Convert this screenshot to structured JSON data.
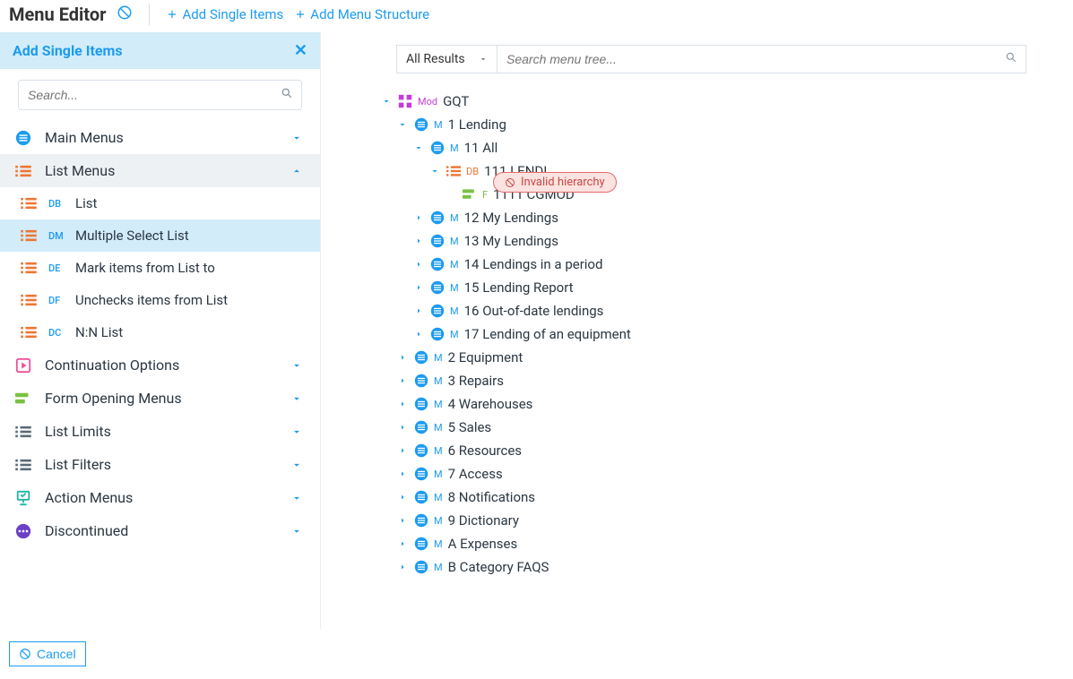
{
  "header": {
    "title": "Menu Editor",
    "add_single": "Add Single Items",
    "add_structure": "Add Menu Structure"
  },
  "sidebar": {
    "panel_title": "Add Single Items",
    "search_placeholder": "Search...",
    "categories": [
      {
        "id": "main-menus",
        "label": "Main Menus",
        "expanded": false,
        "type": "blue"
      },
      {
        "id": "list-menus",
        "label": "List Menus",
        "expanded": true,
        "type": "orange",
        "subs": [
          {
            "code": "DB",
            "label": "List",
            "selected": false
          },
          {
            "code": "DM",
            "label": "Multiple Select List",
            "selected": true
          },
          {
            "code": "DE",
            "label": "Mark items from List to",
            "selected": false
          },
          {
            "code": "DF",
            "label": "Unchecks items from List",
            "selected": false
          },
          {
            "code": "DC",
            "label": "N:N List",
            "selected": false
          }
        ]
      },
      {
        "id": "continuation",
        "label": "Continuation Options",
        "expanded": false,
        "type": "pink"
      },
      {
        "id": "form-opening",
        "label": "Form Opening Menus",
        "expanded": false,
        "type": "green"
      },
      {
        "id": "list-limits",
        "label": "List Limits",
        "expanded": false,
        "type": "grey"
      },
      {
        "id": "list-filters",
        "label": "List Filters",
        "expanded": false,
        "type": "grey"
      },
      {
        "id": "action-menus",
        "label": "Action Menus",
        "expanded": false,
        "type": "teal"
      },
      {
        "id": "discontinued",
        "label": "Discontinued",
        "expanded": false,
        "type": "purple"
      }
    ]
  },
  "main": {
    "filter_select": "All Results",
    "search_placeholder": "Search menu tree...",
    "invalid_badge": "Invalid hierarchy",
    "tree": {
      "type": "Mod",
      "code": "GQT",
      "expanded": true,
      "children": [
        {
          "type": "M",
          "code": "1",
          "label": "Lending",
          "expanded": true,
          "children": [
            {
              "type": "M",
              "code": "11",
              "label": "All",
              "expanded": true,
              "children": [
                {
                  "type": "DB",
                  "code": "111",
                  "label": "LENDI",
                  "expanded": true,
                  "db": true,
                  "children": [
                    {
                      "type": "F",
                      "code": "1111",
                      "label": "CGMOD",
                      "leaf": true,
                      "invalid": true
                    }
                  ]
                }
              ]
            },
            {
              "type": "M",
              "code": "12",
              "label": "My Lendings"
            },
            {
              "type": "M",
              "code": "13",
              "label": "My Lendings"
            },
            {
              "type": "M",
              "code": "14",
              "label": "Lendings in a period"
            },
            {
              "type": "M",
              "code": "15",
              "label": "Lending Report"
            },
            {
              "type": "M",
              "code": "16",
              "label": "Out-of-date lendings"
            },
            {
              "type": "M",
              "code": "17",
              "label": "Lending of an equipment"
            }
          ]
        },
        {
          "type": "M",
          "code": "2",
          "label": "Equipment"
        },
        {
          "type": "M",
          "code": "3",
          "label": "Repairs"
        },
        {
          "type": "M",
          "code": "4",
          "label": "Warehouses"
        },
        {
          "type": "M",
          "code": "5",
          "label": "Sales"
        },
        {
          "type": "M",
          "code": "6",
          "label": "Resources"
        },
        {
          "type": "M",
          "code": "7",
          "label": "Access"
        },
        {
          "type": "M",
          "code": "8",
          "label": "Notifications"
        },
        {
          "type": "M",
          "code": "9",
          "label": "Dictionary"
        },
        {
          "type": "M",
          "code": "A",
          "label": "Expenses"
        },
        {
          "type": "M",
          "code": "B",
          "label": "Category FAQS"
        }
      ]
    }
  },
  "footer": {
    "cancel": "Cancel"
  },
  "colors": {
    "blue": "#1d9bf0",
    "orange": "#ed7634",
    "pink": "#ef4f9b",
    "green": "#7ac143",
    "grey": "#5a6b78",
    "teal": "#1fb6a4",
    "purple": "#6c3fc7"
  }
}
